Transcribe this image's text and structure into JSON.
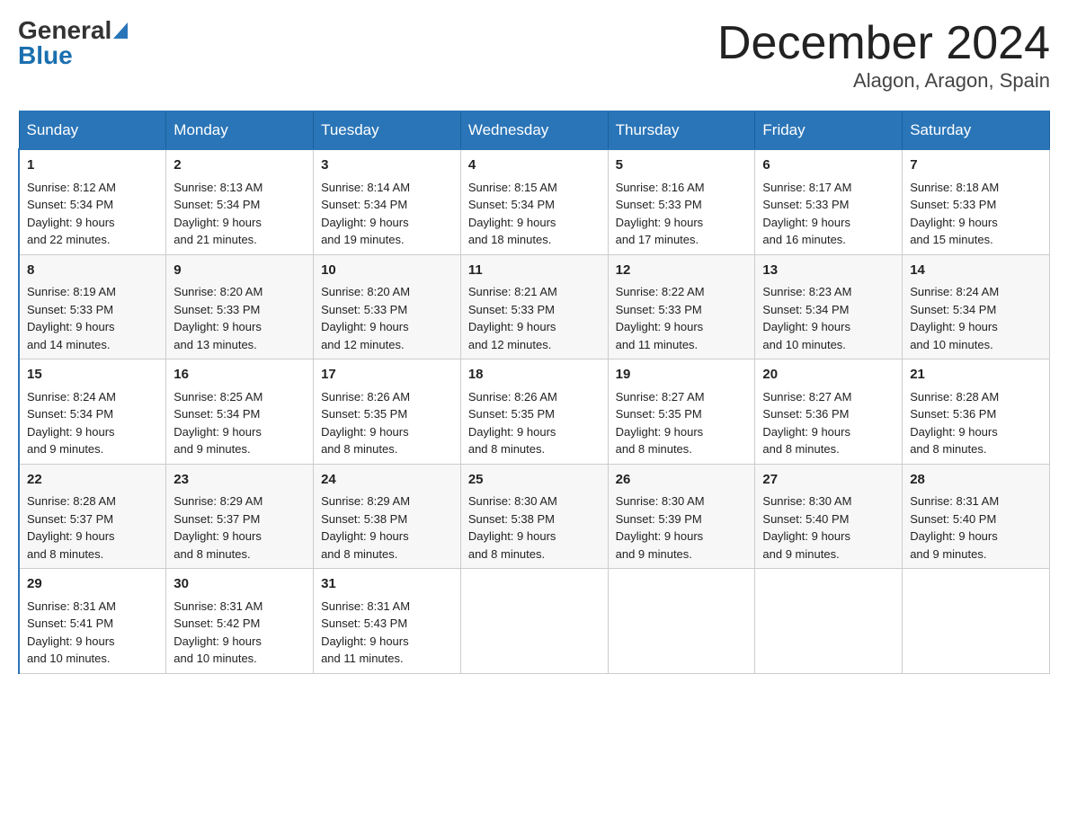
{
  "header": {
    "logo_general": "General",
    "logo_blue": "Blue",
    "month_title": "December 2024",
    "location": "Alagon, Aragon, Spain"
  },
  "days_of_week": [
    "Sunday",
    "Monday",
    "Tuesday",
    "Wednesday",
    "Thursday",
    "Friday",
    "Saturday"
  ],
  "weeks": [
    [
      {
        "day": "1",
        "sunrise": "8:12 AM",
        "sunset": "5:34 PM",
        "daylight": "9 hours and 22 minutes."
      },
      {
        "day": "2",
        "sunrise": "8:13 AM",
        "sunset": "5:34 PM",
        "daylight": "9 hours and 21 minutes."
      },
      {
        "day": "3",
        "sunrise": "8:14 AM",
        "sunset": "5:34 PM",
        "daylight": "9 hours and 19 minutes."
      },
      {
        "day": "4",
        "sunrise": "8:15 AM",
        "sunset": "5:34 PM",
        "daylight": "9 hours and 18 minutes."
      },
      {
        "day": "5",
        "sunrise": "8:16 AM",
        "sunset": "5:33 PM",
        "daylight": "9 hours and 17 minutes."
      },
      {
        "day": "6",
        "sunrise": "8:17 AM",
        "sunset": "5:33 PM",
        "daylight": "9 hours and 16 minutes."
      },
      {
        "day": "7",
        "sunrise": "8:18 AM",
        "sunset": "5:33 PM",
        "daylight": "9 hours and 15 minutes."
      }
    ],
    [
      {
        "day": "8",
        "sunrise": "8:19 AM",
        "sunset": "5:33 PM",
        "daylight": "9 hours and 14 minutes."
      },
      {
        "day": "9",
        "sunrise": "8:20 AM",
        "sunset": "5:33 PM",
        "daylight": "9 hours and 13 minutes."
      },
      {
        "day": "10",
        "sunrise": "8:20 AM",
        "sunset": "5:33 PM",
        "daylight": "9 hours and 12 minutes."
      },
      {
        "day": "11",
        "sunrise": "8:21 AM",
        "sunset": "5:33 PM",
        "daylight": "9 hours and 12 minutes."
      },
      {
        "day": "12",
        "sunrise": "8:22 AM",
        "sunset": "5:33 PM",
        "daylight": "9 hours and 11 minutes."
      },
      {
        "day": "13",
        "sunrise": "8:23 AM",
        "sunset": "5:34 PM",
        "daylight": "9 hours and 10 minutes."
      },
      {
        "day": "14",
        "sunrise": "8:24 AM",
        "sunset": "5:34 PM",
        "daylight": "9 hours and 10 minutes."
      }
    ],
    [
      {
        "day": "15",
        "sunrise": "8:24 AM",
        "sunset": "5:34 PM",
        "daylight": "9 hours and 9 minutes."
      },
      {
        "day": "16",
        "sunrise": "8:25 AM",
        "sunset": "5:34 PM",
        "daylight": "9 hours and 9 minutes."
      },
      {
        "day": "17",
        "sunrise": "8:26 AM",
        "sunset": "5:35 PM",
        "daylight": "9 hours and 8 minutes."
      },
      {
        "day": "18",
        "sunrise": "8:26 AM",
        "sunset": "5:35 PM",
        "daylight": "9 hours and 8 minutes."
      },
      {
        "day": "19",
        "sunrise": "8:27 AM",
        "sunset": "5:35 PM",
        "daylight": "9 hours and 8 minutes."
      },
      {
        "day": "20",
        "sunrise": "8:27 AM",
        "sunset": "5:36 PM",
        "daylight": "9 hours and 8 minutes."
      },
      {
        "day": "21",
        "sunrise": "8:28 AM",
        "sunset": "5:36 PM",
        "daylight": "9 hours and 8 minutes."
      }
    ],
    [
      {
        "day": "22",
        "sunrise": "8:28 AM",
        "sunset": "5:37 PM",
        "daylight": "9 hours and 8 minutes."
      },
      {
        "day": "23",
        "sunrise": "8:29 AM",
        "sunset": "5:37 PM",
        "daylight": "9 hours and 8 minutes."
      },
      {
        "day": "24",
        "sunrise": "8:29 AM",
        "sunset": "5:38 PM",
        "daylight": "9 hours and 8 minutes."
      },
      {
        "day": "25",
        "sunrise": "8:30 AM",
        "sunset": "5:38 PM",
        "daylight": "9 hours and 8 minutes."
      },
      {
        "day": "26",
        "sunrise": "8:30 AM",
        "sunset": "5:39 PM",
        "daylight": "9 hours and 9 minutes."
      },
      {
        "day": "27",
        "sunrise": "8:30 AM",
        "sunset": "5:40 PM",
        "daylight": "9 hours and 9 minutes."
      },
      {
        "day": "28",
        "sunrise": "8:31 AM",
        "sunset": "5:40 PM",
        "daylight": "9 hours and 9 minutes."
      }
    ],
    [
      {
        "day": "29",
        "sunrise": "8:31 AM",
        "sunset": "5:41 PM",
        "daylight": "9 hours and 10 minutes."
      },
      {
        "day": "30",
        "sunrise": "8:31 AM",
        "sunset": "5:42 PM",
        "daylight": "9 hours and 10 minutes."
      },
      {
        "day": "31",
        "sunrise": "8:31 AM",
        "sunset": "5:43 PM",
        "daylight": "9 hours and 11 minutes."
      },
      null,
      null,
      null,
      null
    ]
  ],
  "labels": {
    "sunrise": "Sunrise:",
    "sunset": "Sunset:",
    "daylight": "Daylight:"
  }
}
